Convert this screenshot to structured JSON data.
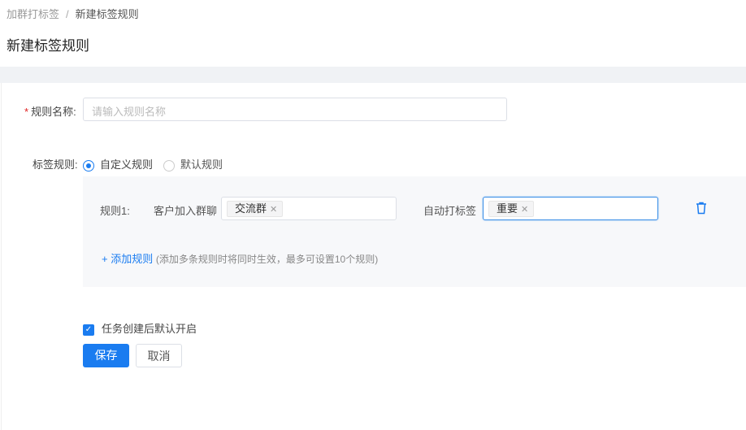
{
  "breadcrumb": {
    "parent": "加群打标签",
    "separator": "/",
    "current": "新建标签规则"
  },
  "page_title": "新建标签规则",
  "form": {
    "name_label": "规则名称:",
    "required_mark": "*",
    "name_placeholder": "请输入规则名称",
    "name_value": "",
    "rule_type_label": "标签规则:",
    "rule_type_options": [
      "自定义规则",
      "默认规则"
    ],
    "rule_type_selected": "自定义规则",
    "rules": [
      {
        "label": "规则1:",
        "condition_label": "客户加入群聊",
        "condition_tags": [
          "交流群"
        ],
        "action_label": "自动打标签",
        "action_tags": [
          "重要"
        ]
      }
    ],
    "add_rule": "+ 添加规则",
    "add_rule_hint": "(添加多条规则时将同时生效，最多可设置10个规则)",
    "enable_checkbox": {
      "label": "任务创建后默认开启",
      "checked": true
    },
    "save_label": "保存",
    "cancel_label": "取消"
  },
  "colors": {
    "primary": "#1a7cf0",
    "required": "#e02020",
    "panel": "#f7f8fa"
  }
}
